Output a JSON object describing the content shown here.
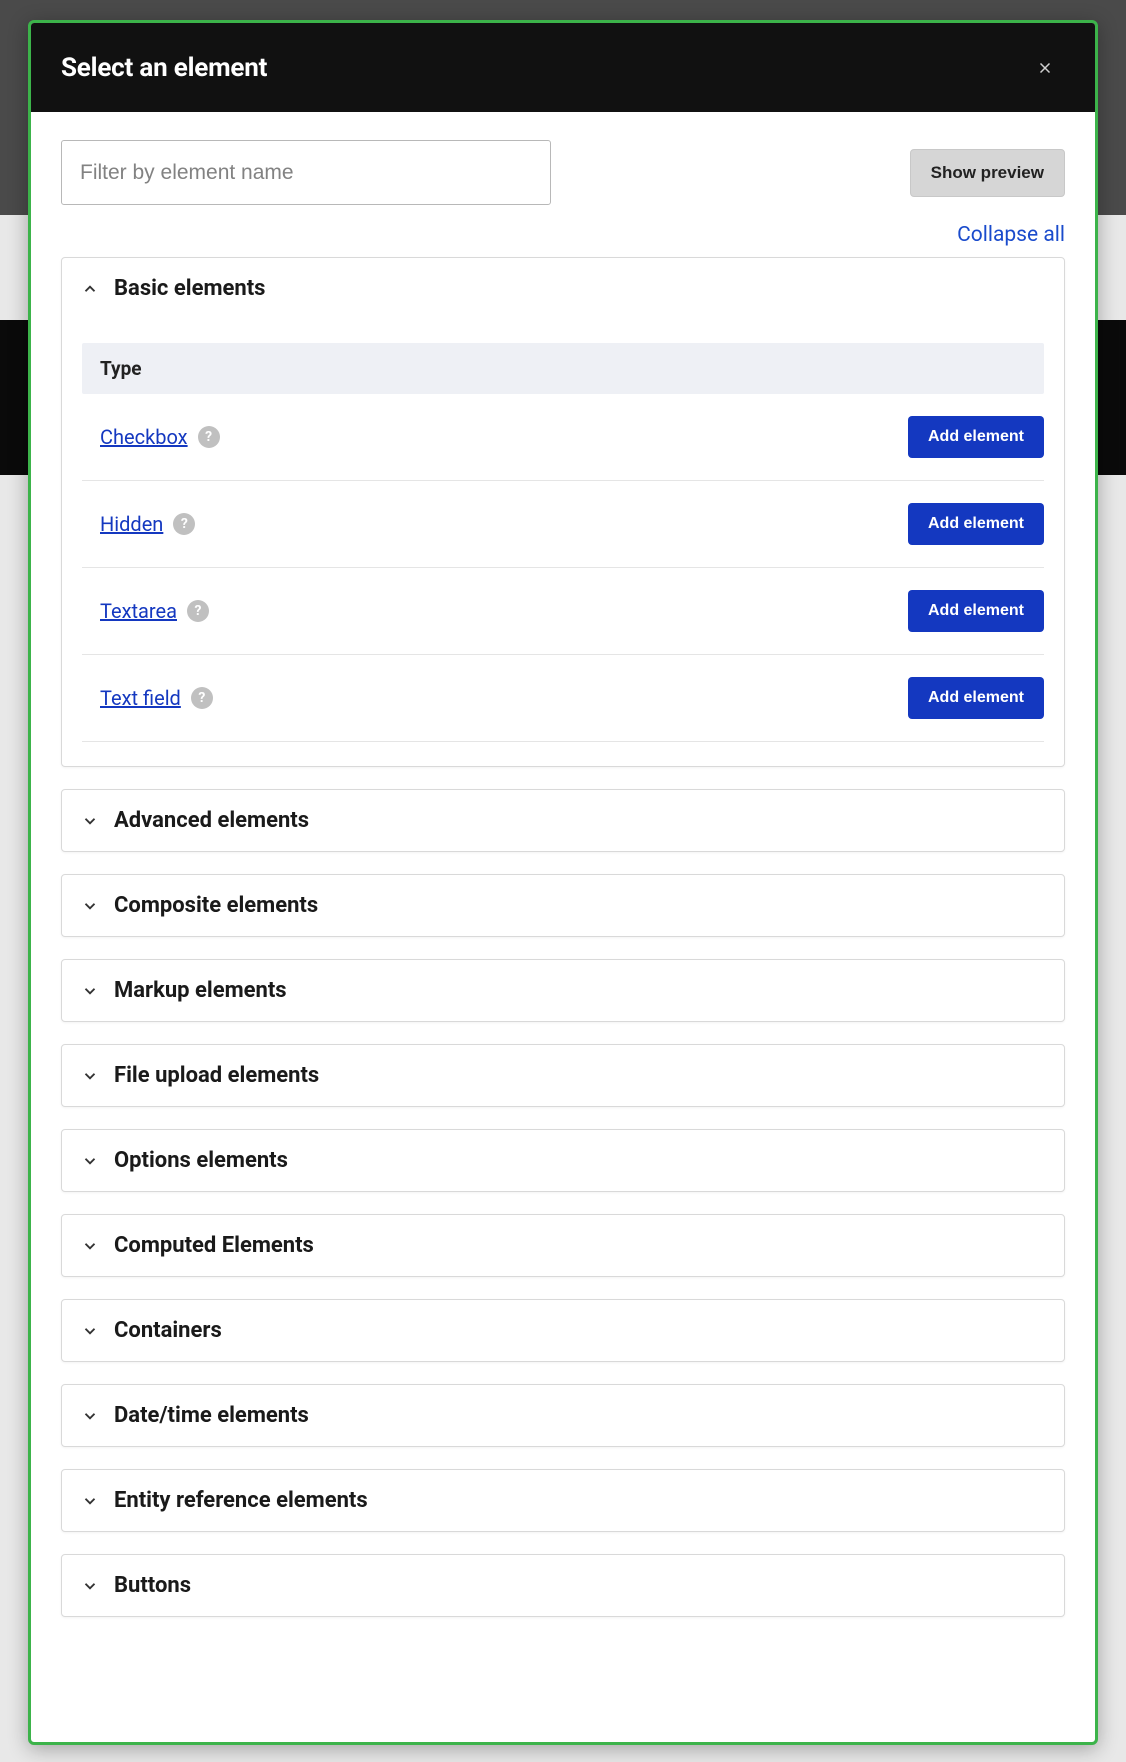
{
  "modal": {
    "title": "Select an element",
    "close_icon": "close"
  },
  "filter": {
    "placeholder": "Filter by element name"
  },
  "actions": {
    "show_preview": "Show preview",
    "collapse_all": "Collapse all",
    "add_element": "Add element"
  },
  "table": {
    "type_header": "Type"
  },
  "sections": {
    "basic": {
      "title": "Basic elements",
      "expanded": true,
      "items": [
        {
          "label": "Checkbox"
        },
        {
          "label": "Hidden"
        },
        {
          "label": "Textarea"
        },
        {
          "label": "Text field"
        }
      ]
    },
    "advanced": {
      "title": "Advanced elements"
    },
    "composite": {
      "title": "Composite elements"
    },
    "markup": {
      "title": "Markup elements"
    },
    "file_upload": {
      "title": "File upload elements"
    },
    "options": {
      "title": "Options elements"
    },
    "computed": {
      "title": "Computed Elements"
    },
    "containers": {
      "title": "Containers"
    },
    "datetime": {
      "title": "Date/time elements"
    },
    "entity_ref": {
      "title": "Entity reference elements"
    },
    "buttons": {
      "title": "Buttons"
    }
  }
}
